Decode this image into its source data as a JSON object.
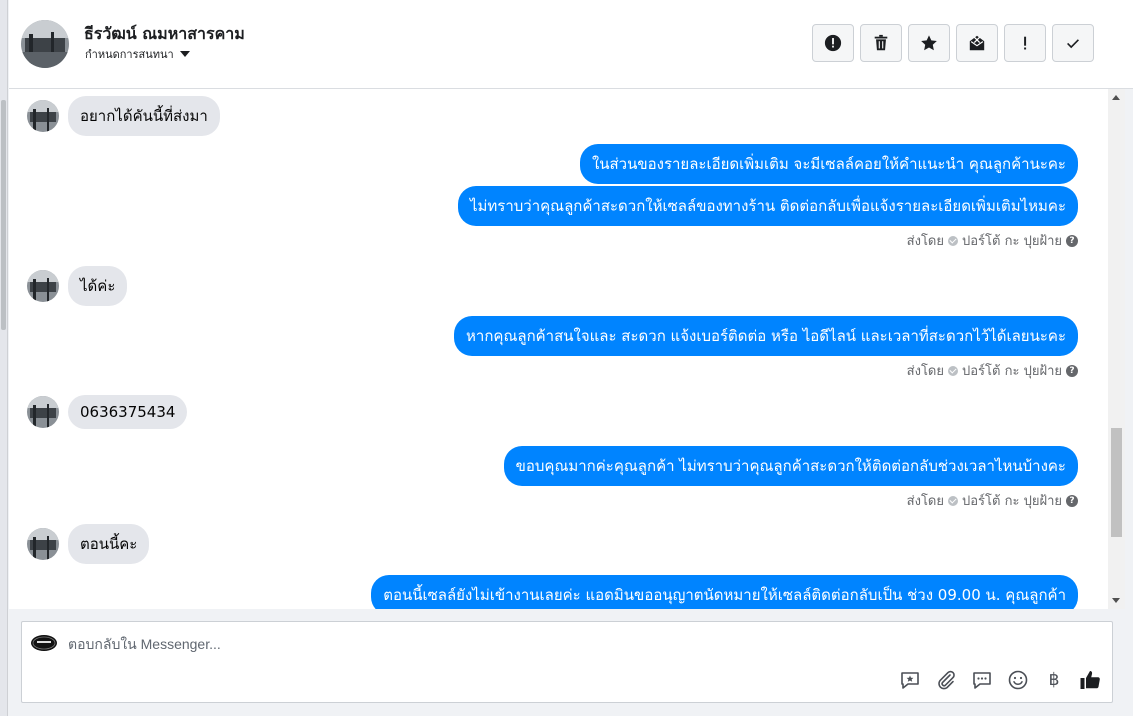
{
  "header": {
    "contact_name": "ธีรวัฒน์ ณมหาสารคาม",
    "assign_label": "กำหนดการสนทนา",
    "actions": [
      {
        "name": "report-button",
        "icon": "alert-circle-icon"
      },
      {
        "name": "delete-button",
        "icon": "trash-icon"
      },
      {
        "name": "star-button",
        "icon": "star-icon"
      },
      {
        "name": "mark-unread-button",
        "icon": "envelope-x-icon"
      },
      {
        "name": "spam-button",
        "icon": "exclamation-icon"
      },
      {
        "name": "done-button",
        "icon": "checkmark-icon"
      }
    ]
  },
  "messages": [
    {
      "dir": "in",
      "text": "อยากได้คันนี้ที่ส่งมา"
    },
    {
      "dir": "out",
      "text": "ในส่วนของรายละเอียดเพิ่มเติม จะมีเซลล์คอยให้คำแนะนำ คุณลูกค้านะคะ"
    },
    {
      "dir": "out",
      "text": "ไม่ทราบว่าคุณลูกค้าสะดวกให้เซลล์ของทางร้าน ติดต่อกลับเพื่อแจ้งรายละเอียดเพิ่มเติมไหมคะ"
    },
    {
      "dir": "in",
      "text": "ได้ค่ะ"
    },
    {
      "dir": "out",
      "text": "หากคุณลูกค้าสนใจและ สะดวก แจ้งเบอร์ติดต่อ หรือ ไอดีไลน์ และเวลาที่สะดวกไว้ได้เลยนะคะ"
    },
    {
      "dir": "in",
      "text": "0636375434"
    },
    {
      "dir": "out",
      "text": "ขอบคุณมากค่ะคุณลูกค้า ไม่ทราบว่าคุณลูกค้าสะดวกให้ติดต่อกลับช่วงเวลาไหนบ้างคะ"
    },
    {
      "dir": "in",
      "text": "ตอนนี้คะ"
    },
    {
      "dir": "out",
      "text": "ตอนนี้เซลล์ยังไม่เข้างานเลยค่ะ แอดมินขออนุญาตนัดหมายให้เซลล์ติดต่อกลับเป็น ช่วง 09.00 น. คุณลูกค้า"
    }
  ],
  "sent_by": {
    "prefix": "ส่งโดย",
    "agent": "ปอร์โต้ กะ ปุยฝ้าย",
    "help": "?"
  },
  "composer": {
    "placeholder": "ตอบกลับใน Messenger...",
    "tools": [
      "saved-reply-icon",
      "attachment-icon",
      "chat-bubble-icon",
      "emoji-icon",
      "baht-icon",
      "thumbs-up-icon"
    ],
    "baht_glyph": "฿"
  },
  "colors": {
    "outgoing_bubble": "#0084ff",
    "incoming_bubble": "#e4e6eb",
    "thumbs_up": "#1c1e21"
  }
}
